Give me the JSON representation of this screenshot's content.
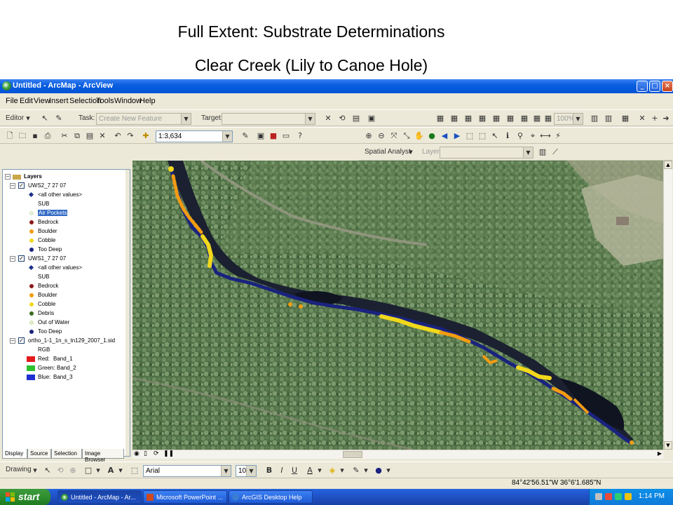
{
  "slide": {
    "title": "Full Extent: Substrate Determinations",
    "subtitle": "Clear Creek (Lily to Canoe Hole)"
  },
  "window": {
    "title": "Untitled - ArcMap - ArcView",
    "minimize": "_",
    "maximize": "□",
    "close": "×"
  },
  "menu": [
    "File",
    "Edit",
    "View",
    "Insert",
    "Selection",
    "Tools",
    "Window",
    "Help"
  ],
  "editor_toolbar": {
    "editor_label": "Editor",
    "task_label": "Task:",
    "task_value": "Create New Feature",
    "target_label": "Target:",
    "target_value": "",
    "zoom_value": "100%"
  },
  "standard_toolbar": {
    "scale_value": "1:3,634"
  },
  "spatial_analyst": {
    "label": "Spatial Analyst",
    "layer_label": "Layer:",
    "layer_value": ""
  },
  "toc": {
    "root": "Layers",
    "layers": [
      {
        "name": "UWS2_7 27 07",
        "field": "SUB",
        "other": "<all other values>",
        "classes": [
          {
            "label": "Air Pockets",
            "color": "#e8f4e0",
            "selected": true
          },
          {
            "label": "Bedrock",
            "color": "#8b1a1a"
          },
          {
            "label": "Boulder",
            "color": "#f39c12"
          },
          {
            "label": "Cobble",
            "color": "#f1d81c"
          },
          {
            "label": "Too Deep",
            "color": "#1a237e"
          }
        ]
      },
      {
        "name": "UWS1_7 27 07",
        "field": "SUB",
        "other": "<all other values>",
        "classes": [
          {
            "label": "Bedrock",
            "color": "#8b1a1a"
          },
          {
            "label": "Boulder",
            "color": "#f39c12"
          },
          {
            "label": "Cobble",
            "color": "#f1d81c"
          },
          {
            "label": "Debris",
            "color": "#3a6b1f"
          },
          {
            "label": "Out of Water",
            "color": "#e0f0c8"
          },
          {
            "label": "Too Deep",
            "color": "#1a237e"
          }
        ]
      },
      {
        "name": "ortho_1-1_1n_s_tn129_2007_1.sid",
        "field": "RGB",
        "bands": [
          {
            "label": "Red:",
            "value": "Band_1",
            "color": "#e31a1c"
          },
          {
            "label": "Green:",
            "value": "Band_2",
            "color": "#2dc12d"
          },
          {
            "label": "Blue:",
            "value": "Band_3",
            "color": "#1f2fd1"
          }
        ]
      }
    ],
    "tabs": [
      "Display",
      "Source",
      "Selection",
      "Image Browser"
    ]
  },
  "drawing_toolbar": {
    "drawing_label": "Drawing",
    "font_value": "Arial",
    "size_value": "10",
    "bold": "B",
    "italic": "I",
    "underline": "U",
    "font_color": "A"
  },
  "status": {
    "coords": "84°42'56.51\"W  36°6'1.685\"N"
  },
  "taskbar": {
    "start": "start",
    "tasks": [
      "Untitled - ArcMap - Ar...",
      "Microsoft PowerPoint ...",
      "ArcGIS Desktop Help"
    ],
    "clock": "1:14 PM"
  },
  "colors": {
    "too_deep": "#1a237e",
    "cobble": "#f1d81c",
    "boulder": "#f39c12",
    "xp_blue": "#0a5fe0"
  }
}
